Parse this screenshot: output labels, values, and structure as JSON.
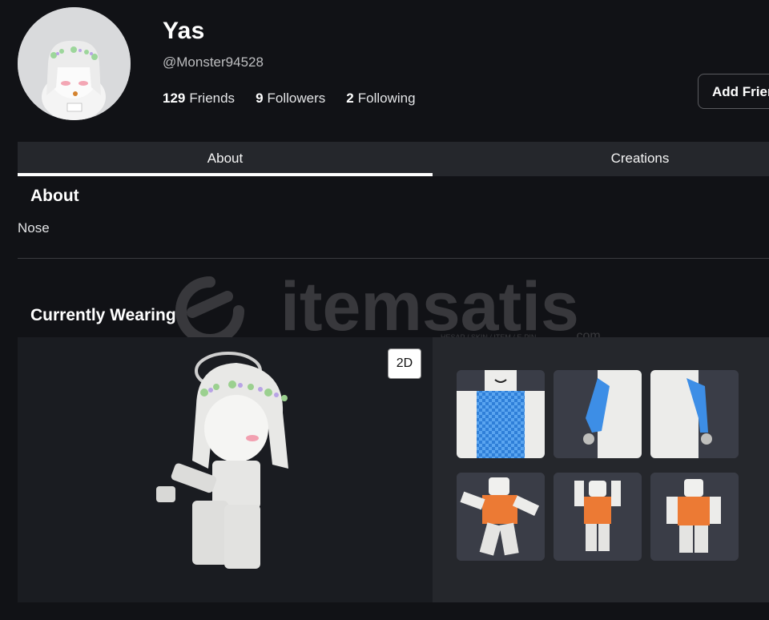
{
  "profile": {
    "display_name": "Yas",
    "username": "@Monster94528",
    "stats": [
      {
        "count": "129",
        "label": "Friends"
      },
      {
        "count": "9",
        "label": "Followers"
      },
      {
        "count": "2",
        "label": "Following"
      }
    ],
    "add_friend_label": "Add Friend"
  },
  "tabs": [
    {
      "label": "About",
      "active": true
    },
    {
      "label": "Creations",
      "active": false
    }
  ],
  "about": {
    "heading": "About",
    "text": "Nose"
  },
  "wearing": {
    "heading": "Currently Wearing",
    "toggle_label": "2D",
    "items": [
      {
        "name": "blue-checkered-shirt"
      },
      {
        "name": "blue-sleeve-right"
      },
      {
        "name": "blue-sleeve-left"
      },
      {
        "name": "orange-outfit-run"
      },
      {
        "name": "orange-outfit-jump"
      },
      {
        "name": "orange-outfit-idle"
      }
    ]
  },
  "watermark": {
    "text": "itemsatis",
    "tagline": "HESAP / SKIN / ITEM / E-PIN",
    "suffix": ".com"
  },
  "colors": {
    "background": "#111216",
    "panel": "#25272c",
    "viewer": "#1a1c21",
    "tile": "#3a3d47",
    "shirt_blue": "#3d8ee6",
    "outfit_orange": "#ec7a34"
  }
}
